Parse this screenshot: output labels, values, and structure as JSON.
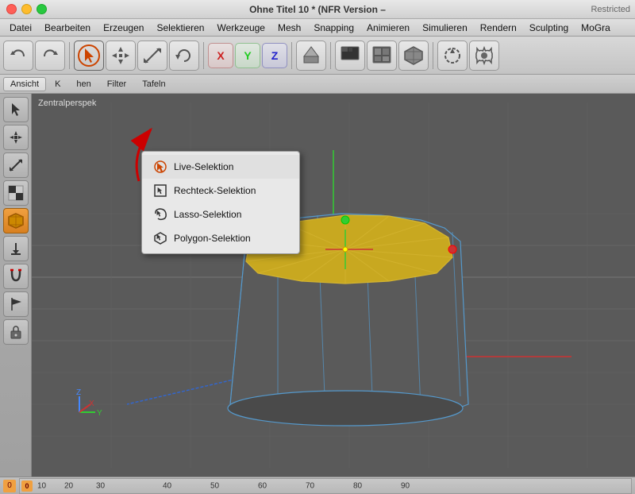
{
  "titlebar": {
    "title": "Ohne Titel 10 * (NFR Version –",
    "restricted": "Restricted"
  },
  "menubar": {
    "items": [
      "Datei",
      "Bearbeiten",
      "Erzeugen",
      "Selektieren",
      "Werkzeuge",
      "Mesh",
      "Snapping",
      "Animieren",
      "Simulieren",
      "Rendern",
      "Sculpting",
      "MoGra"
    ]
  },
  "toolbar": {
    "buttons": [
      {
        "name": "undo",
        "icon": "↺"
      },
      {
        "name": "redo",
        "icon": "↻"
      },
      {
        "name": "select-cursor",
        "icon": "↖",
        "active": true,
        "circle": true
      },
      {
        "name": "move",
        "icon": "✥"
      },
      {
        "name": "scale",
        "icon": "⤡"
      },
      {
        "name": "rotate",
        "icon": "↻"
      },
      {
        "name": "x-symbol",
        "icon": "✕"
      },
      {
        "name": "y-symbol",
        "icon": "Y"
      },
      {
        "name": "z-symbol",
        "icon": "Z"
      },
      {
        "name": "extrude",
        "icon": "⬆"
      },
      {
        "name": "film",
        "icon": "🎬"
      },
      {
        "name": "render1",
        "icon": "▣"
      },
      {
        "name": "render2",
        "icon": "▥"
      },
      {
        "name": "cube",
        "icon": "⬛"
      },
      {
        "name": "rotate2",
        "icon": "↺"
      },
      {
        "name": "gear",
        "icon": "⚙"
      },
      {
        "name": "flower",
        "icon": "✿"
      }
    ]
  },
  "toolbar2": {
    "tabs": [
      "Ansicht",
      "K",
      "hen",
      "Filter",
      "Tafeln"
    ]
  },
  "sidebar": {
    "buttons": [
      {
        "name": "cursor-tool",
        "icon": "↖"
      },
      {
        "name": "move-tool",
        "icon": "✥"
      },
      {
        "name": "scale-tool",
        "icon": "⤡"
      },
      {
        "name": "checkerboard",
        "icon": "▦"
      },
      {
        "name": "cube-3d",
        "icon": "⬛",
        "active": true,
        "orange": true
      },
      {
        "name": "arrow-down",
        "icon": "↓"
      },
      {
        "name": "magnet",
        "icon": "🧲"
      },
      {
        "name": "flag",
        "icon": "⚑"
      },
      {
        "name": "lock",
        "icon": "🔒"
      }
    ]
  },
  "viewport": {
    "label": "Zentralperspek"
  },
  "dropdown": {
    "items": [
      {
        "label": "Live-Selektion",
        "active": true
      },
      {
        "label": "Rechteck-Selektion",
        "active": false
      },
      {
        "label": "Lasso-Selektion",
        "active": false
      },
      {
        "label": "Polygon-Selektion",
        "active": false
      }
    ]
  },
  "timeline": {
    "markers": [
      "0",
      "10",
      "20",
      "30",
      "40",
      "50",
      "60",
      "70",
      "80",
      "90"
    ]
  }
}
